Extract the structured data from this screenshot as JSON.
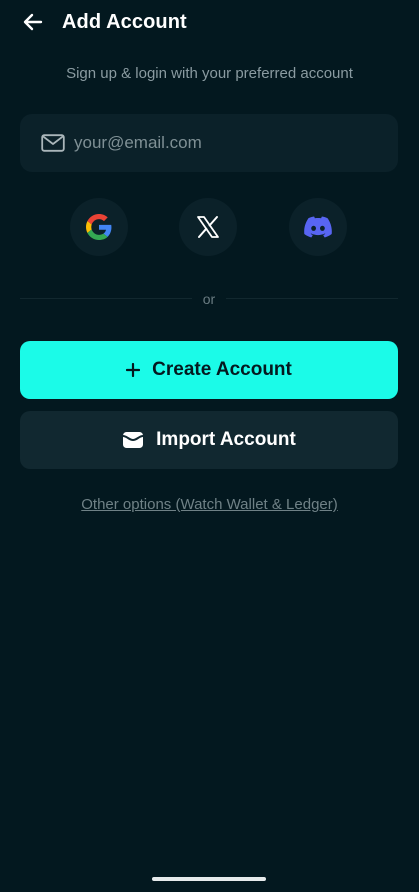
{
  "header": {
    "title": "Add Account",
    "back_icon": "arrow-left-icon"
  },
  "subtitle": "Sign up & login with your preferred account",
  "email": {
    "placeholder": "your@email.com",
    "value": "",
    "icon": "envelope-icon"
  },
  "social": [
    {
      "name": "Google",
      "icon": "google-icon"
    },
    {
      "name": "X",
      "icon": "x-icon"
    },
    {
      "name": "Discord",
      "icon": "discord-icon"
    }
  ],
  "divider_text": "or",
  "buttons": {
    "create_label": "Create Account",
    "create_icon": "plus-icon",
    "import_label": "Import Account",
    "import_icon": "wallet-icon"
  },
  "other_options_label": "Other options (Watch Wallet & Ledger)",
  "colors": {
    "background": "#03181f",
    "accent": "#1bfbe8",
    "surface": "#0b2129",
    "muted_text": "#8a9ba1",
    "discord": "#5865f2"
  }
}
